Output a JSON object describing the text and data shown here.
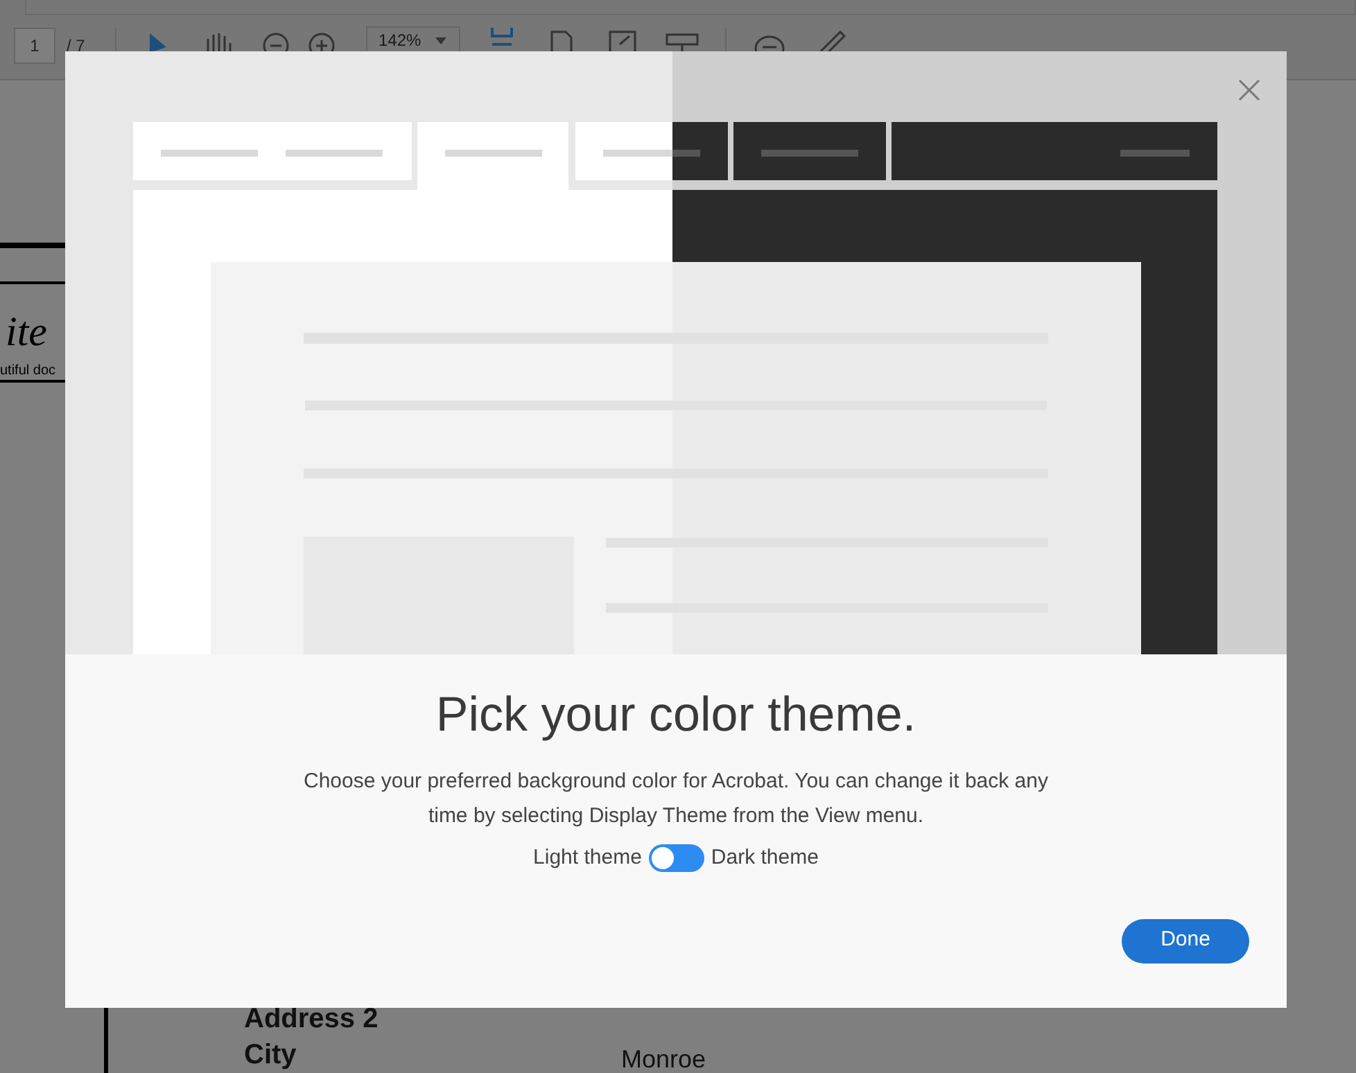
{
  "toolbar": {
    "page_number": "1",
    "page_count": "/ 7",
    "zoom": "142%"
  },
  "document": {
    "script_fragment": "ite",
    "tagline_fragment": "utiful doc",
    "fields": [
      {
        "label": "Address 2"
      },
      {
        "label": "City",
        "value": "Monroe"
      }
    ]
  },
  "dialog": {
    "title": "Pick your color theme.",
    "description": "Choose your preferred background color for Acrobat. You can change it back any time by selecting Display Theme from the View menu.",
    "toggle": {
      "left_label": "Light theme",
      "right_label": "Dark theme",
      "on": false
    },
    "done_button": "Done"
  }
}
